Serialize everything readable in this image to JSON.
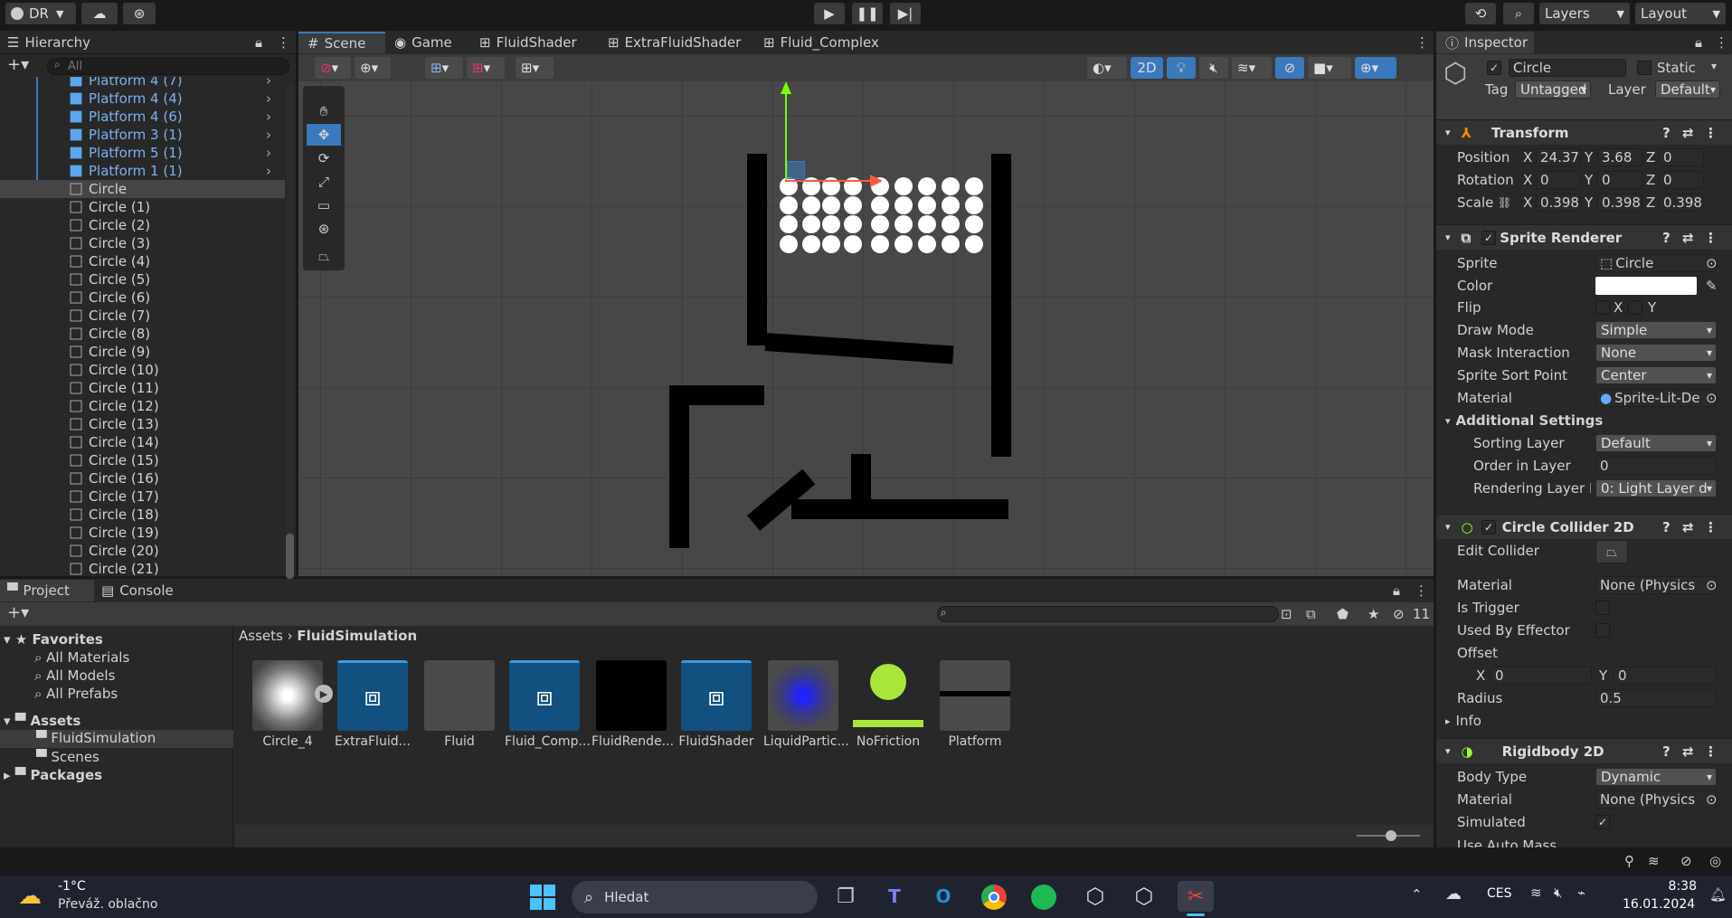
{
  "topbar": {
    "account": "DR",
    "layers": "Layers",
    "layout": "Layout"
  },
  "tabs": {
    "hierarchy": "Hierarchy",
    "scene": "Scene",
    "game": "Game",
    "fluid_shader": "FluidShader",
    "extra_fluid_shader": "ExtraFluidShader",
    "fluid_complex": "Fluid_Complex",
    "inspector": "Inspector",
    "project": "Project",
    "console": "Console"
  },
  "hierarchy": {
    "search_placeholder": "All",
    "items": [
      "Platform 4 (7)",
      "Platform 4 (4)",
      "Platform 4 (6)",
      "Platform 3 (1)",
      "Platform 5 (1)",
      "Platform 1 (1)",
      "Circle",
      "Circle (1)",
      "Circle (2)",
      "Circle (3)",
      "Circle (4)",
      "Circle (5)",
      "Circle (6)",
      "Circle (7)",
      "Circle (8)",
      "Circle (9)",
      "Circle (10)",
      "Circle (11)",
      "Circle (12)",
      "Circle (13)",
      "Circle (14)",
      "Circle (15)",
      "Circle (16)",
      "Circle (17)",
      "Circle (18)",
      "Circle (19)",
      "Circle (20)",
      "Circle (21)"
    ]
  },
  "scene": {
    "mode_2d": "2D"
  },
  "project": {
    "favorites": "Favorites",
    "fav_items": [
      "All Materials",
      "All Models",
      "All Prefabs"
    ],
    "assets": "Assets",
    "asset_folders": [
      "FluidSimulation",
      "Scenes"
    ],
    "packages": "Packages",
    "breadcrumb": [
      "Assets",
      "FluidSimulation"
    ],
    "hidden_count": "11",
    "files": [
      "Circle_4",
      "ExtraFluid...",
      "Fluid",
      "Fluid_Comp...",
      "FluidRende...",
      "FluidShader",
      "LiquidPartic...",
      "NoFriction",
      "Platform"
    ]
  },
  "inspector": {
    "object_name": "Circle",
    "static": "Static",
    "tag_label": "Tag",
    "tag": "Untagged",
    "layer_label": "Layer",
    "layer": "Default",
    "transform": "Transform",
    "position_label": "Position",
    "pos_x": "24.37",
    "pos_y": "3.68",
    "pos_z": "0",
    "rotation_label": "Rotation",
    "rot_x": "0",
    "rot_y": "0",
    "rot_z": "0",
    "scale_label": "Scale",
    "scale_x": "0.398",
    "scale_y": "0.398",
    "scale_z": "0.398",
    "axis_x": "X",
    "axis_y": "Y",
    "axis_z": "Z",
    "sprite_renderer": "Sprite Renderer",
    "sprite_label": "Sprite",
    "sprite": "Circle",
    "color_label": "Color",
    "flip_label": "Flip",
    "draw_mode_label": "Draw Mode",
    "draw_mode": "Simple",
    "mask_label": "Mask Interaction",
    "mask": "None",
    "sort_point_label": "Sprite Sort Point",
    "sort_point": "Center",
    "material_label": "Material",
    "material": "Sprite-Lit-De",
    "additional": "Additional Settings",
    "sorting_layer_label": "Sorting Layer",
    "sorting_layer": "Default",
    "order_label": "Order in Layer",
    "order": "0",
    "rendering_layer_label": "Rendering Layer M",
    "rendering_layer": "0: Light Layer d",
    "circle_collider": "Circle Collider 2D",
    "edit_collider_label": "Edit Collider",
    "cc_material": "None (Physics",
    "is_trigger_label": "Is Trigger",
    "effector_label": "Used By Effector",
    "offset_label": "Offset",
    "offset_x": "0",
    "offset_y": "0",
    "radius_label": "Radius",
    "radius": "0.5",
    "info_label": "Info",
    "rigidbody": "Rigidbody 2D",
    "body_type_label": "Body Type",
    "body_type": "Dynamic",
    "rb_material": "None (Physics",
    "simulated_label": "Simulated",
    "use_auto_mass_label": "Use Auto Mass"
  },
  "taskbar": {
    "temp": "-1°C",
    "weather": "Převáž. oblačno",
    "search": "Hledat",
    "lang": "CES",
    "time": "8:38",
    "date": "16.01.2024"
  }
}
